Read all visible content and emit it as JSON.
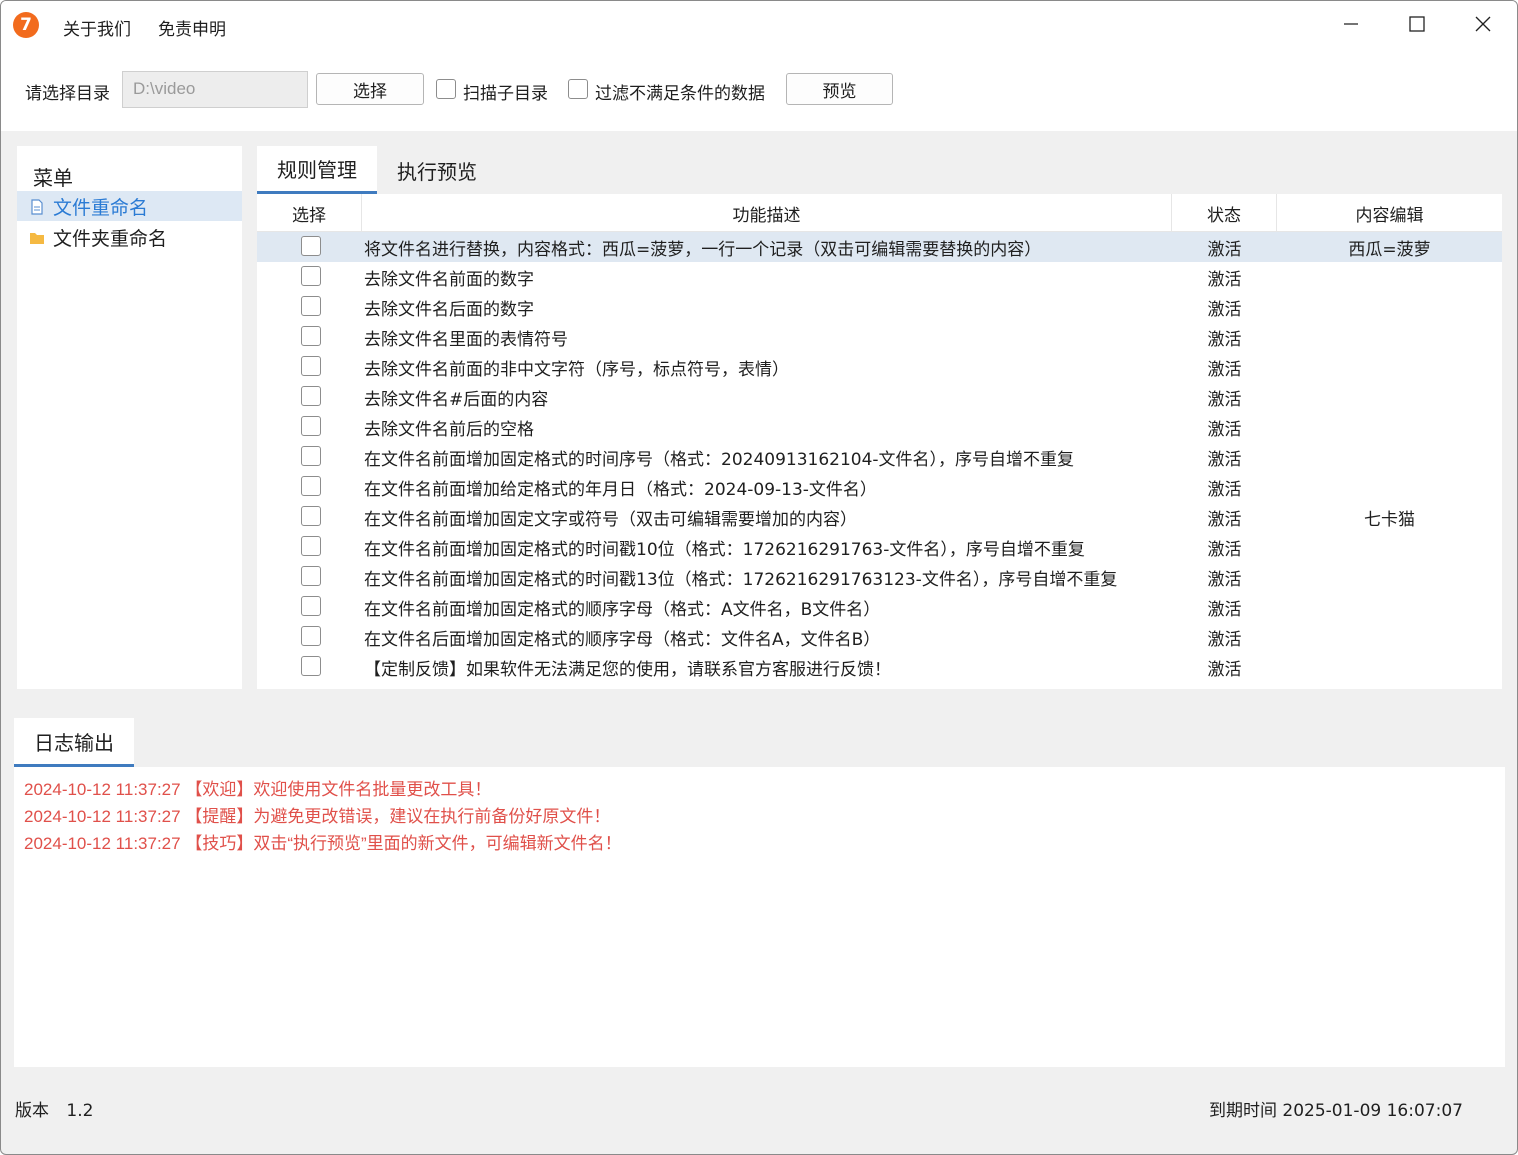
{
  "titlebar": {
    "app_icon_text": "7",
    "menu": [
      "关于我们",
      "免责申明"
    ],
    "minimize": "—",
    "maximize": "☐",
    "close": "✕"
  },
  "toolbar": {
    "dir_label": "请选择目录",
    "dir_value": "D:\\video",
    "choose_button": "选择",
    "scan_subdir_label": "扫描子目录",
    "filter_label": "过滤不满足条件的数据",
    "preview_button": "预览"
  },
  "sidebar": {
    "title": "菜单",
    "items": [
      {
        "label": "文件重命名",
        "icon": "file-icon"
      },
      {
        "label": "文件夹重命名",
        "icon": "folder-icon"
      }
    ]
  },
  "tabs": [
    {
      "label": "规则管理"
    },
    {
      "label": "执行预览"
    }
  ],
  "table": {
    "headers": [
      "选择",
      "功能描述",
      "状态",
      "内容编辑"
    ],
    "rows": [
      {
        "desc": "将文件名进行替换，内容格式：西瓜=菠萝，一行一个记录（双击可编辑需要替换的内容）",
        "status": "激活",
        "content": "西瓜=菠萝"
      },
      {
        "desc": "去除文件名前面的数字",
        "status": "激活",
        "content": ""
      },
      {
        "desc": "去除文件名后面的数字",
        "status": "激活",
        "content": ""
      },
      {
        "desc": "去除文件名里面的表情符号",
        "status": "激活",
        "content": ""
      },
      {
        "desc": "去除文件名前面的非中文字符（序号，标点符号，表情）",
        "status": "激活",
        "content": ""
      },
      {
        "desc": "去除文件名#后面的内容",
        "status": "激活",
        "content": ""
      },
      {
        "desc": "去除文件名前后的空格",
        "status": "激活",
        "content": ""
      },
      {
        "desc": "在文件名前面增加固定格式的时间序号（格式：20240913162104-文件名），序号自增不重复",
        "status": "激活",
        "content": ""
      },
      {
        "desc": "在文件名前面增加给定格式的年月日（格式：2024-09-13-文件名）",
        "status": "激活",
        "content": ""
      },
      {
        "desc": "在文件名前面增加固定文字或符号（双击可编辑需要增加的内容）",
        "status": "激活",
        "content": "七卡猫"
      },
      {
        "desc": "在文件名前面增加固定格式的时间戳10位（格式：1726216291763-文件名），序号自增不重复",
        "status": "激活",
        "content": ""
      },
      {
        "desc": "在文件名前面增加固定格式的时间戳13位（格式：1726216291763123-文件名），序号自增不重复",
        "status": "激活",
        "content": ""
      },
      {
        "desc": "在文件名前面增加固定格式的顺序字母（格式：A文件名，B文件名）",
        "status": "激活",
        "content": ""
      },
      {
        "desc": "在文件名后面增加固定格式的顺序字母（格式：文件名A，文件名B）",
        "status": "激活",
        "content": ""
      },
      {
        "desc": "【定制反馈】如果软件无法满足您的使用，请联系官方客服进行反馈！",
        "status": "激活",
        "content": ""
      }
    ]
  },
  "log": {
    "tab_label": "日志输出",
    "lines": [
      "2024-10-12 11:37:27 【欢迎】欢迎使用文件名批量更改工具！",
      "2024-10-12 11:37:27 【提醒】为避免更改错误，建议在执行前备份好原文件！",
      "2024-10-12 11:37:27 【技巧】双击“执行预览”里面的新文件，可编辑新文件名！"
    ],
    "color": "#e0504a"
  },
  "footer": {
    "version_label": "版本",
    "version_value": "1.2",
    "expiry": "到期时间 2025-01-09 16:07:07"
  },
  "colors": {
    "accent": "#3f7bbf",
    "app_icon": "#f26b1d",
    "selected_row": "#dfe8f2",
    "sidebar_active": "#2b7bd4"
  }
}
